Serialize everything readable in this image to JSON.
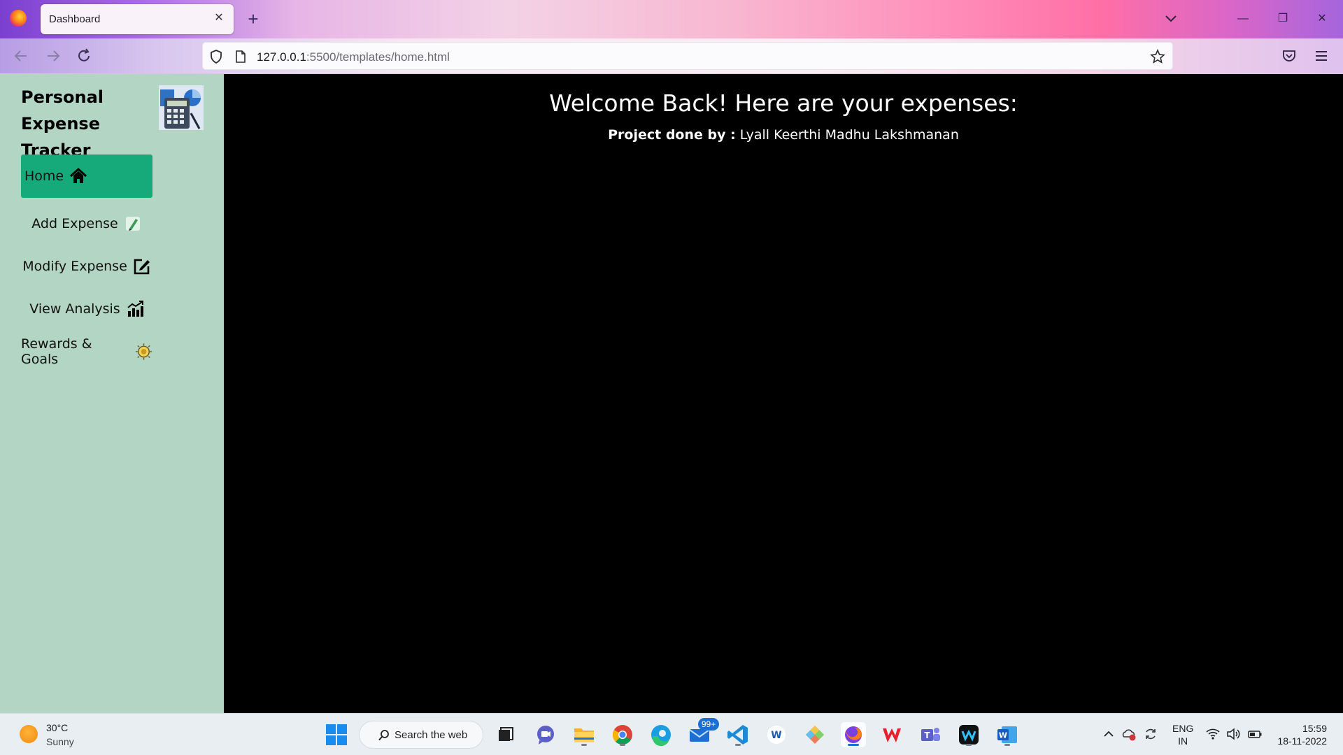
{
  "browser": {
    "tab_title": "Dashboard",
    "tab_close": "✕",
    "new_tab": "+",
    "url_host": "127.0.0.1",
    "url_path": ":5500/templates/home.html",
    "window_minimize": "—",
    "window_restore": "❐",
    "window_close": "✕"
  },
  "sidebar": {
    "title": "Personal Expense Tracker",
    "items": [
      {
        "label": "Home",
        "icon": "home-icon",
        "active": true
      },
      {
        "label": "Add Expense",
        "icon": "add-expense-icon",
        "active": false
      },
      {
        "label": "Modify Expense",
        "icon": "edit-icon",
        "active": false
      },
      {
        "label": "View Analysis",
        "icon": "chart-icon",
        "active": false
      },
      {
        "label": "Rewards & Goals",
        "icon": "reward-icon",
        "active": false
      }
    ]
  },
  "main": {
    "heading": "Welcome Back! Here are your expenses:",
    "credit_label": "Project done by :",
    "credit_name": "Lyall Keerthi Madhu Lakshmanan"
  },
  "taskbar": {
    "weather_temp": "30°C",
    "weather_condition": "Sunny",
    "search_label": "Search the web",
    "mail_badge": "99+",
    "language_line1": "ENG",
    "language_line2": "IN",
    "time": "15:59",
    "date": "18-11-2022"
  },
  "colors": {
    "sidebar_bg": "#b3d5c3",
    "active_nav": "#16a97a",
    "main_bg": "#000000"
  }
}
